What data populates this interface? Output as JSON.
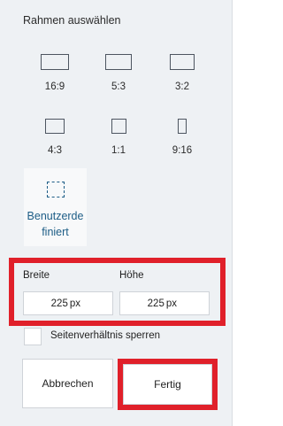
{
  "panel": {
    "title": "Rahmen auswählen"
  },
  "frames": [
    {
      "label": "16:9",
      "icon": "aspect-16-9-icon"
    },
    {
      "label": "5:3",
      "icon": "aspect-5-3-icon"
    },
    {
      "label": "3:2",
      "icon": "aspect-3-2-icon"
    },
    {
      "label": "4:3",
      "icon": "aspect-4-3-icon"
    },
    {
      "label": "1:1",
      "icon": "aspect-1-1-icon"
    },
    {
      "label": "9:16",
      "icon": "aspect-9-16-icon"
    }
  ],
  "custom": {
    "label": "Benutzerdefiniert",
    "icon": "dashed-frame-icon"
  },
  "dimensions": {
    "width_label": "Breite",
    "width_value": "225",
    "height_label": "Höhe",
    "height_value": "225",
    "unit": "px"
  },
  "lock_aspect": {
    "label": "Seitenverhältnis sperren",
    "checked": false
  },
  "buttons": {
    "cancel_label": "Abbrechen",
    "done_label": "Fertig"
  },
  "colors": {
    "highlight": "#e0202a",
    "accent_text": "#1d5d86",
    "panel_bg": "#eef1f4"
  }
}
